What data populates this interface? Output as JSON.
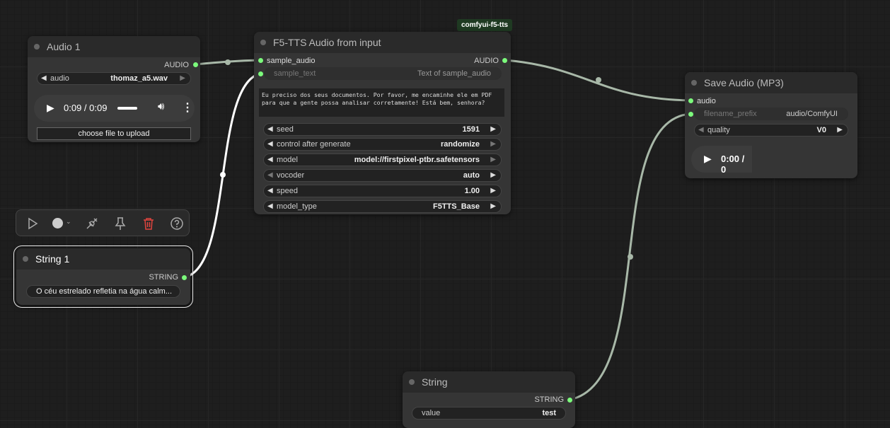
{
  "nodes": {
    "audio1": {
      "title": "Audio 1",
      "output": "AUDIO",
      "widget": {
        "label": "audio",
        "value": "thomaz_a5.wav"
      },
      "player": {
        "time": "0:09 / 0:09"
      },
      "upload_button": "choose file to upload"
    },
    "string1": {
      "title": "String 1",
      "output": "STRING",
      "value": "O céu estrelado refletia na água calm..."
    },
    "f5tts": {
      "title": "F5-TTS Audio from input",
      "badge": "comfyui-f5-tts",
      "inputs": [
        "sample_audio",
        "sample_text"
      ],
      "output": "AUDIO",
      "sample_text_hint": "Text of sample_audio",
      "text": "Eu preciso dos seus documentos. Por favor, me encaminhe ele em PDF para que a gente possa analisar corretamente! Está bem, senhora?",
      "widgets": [
        {
          "label": "seed",
          "value": "1591"
        },
        {
          "label": "control after generate",
          "value": "randomize"
        },
        {
          "label": "model",
          "value": "model://firstpixel-ptbr.safetensors"
        },
        {
          "label": "vocoder",
          "value": "auto"
        },
        {
          "label": "speed",
          "value": "1.00"
        },
        {
          "label": "model_type",
          "value": "F5TTS_Base"
        }
      ]
    },
    "save_audio": {
      "title": "Save Audio (MP3)",
      "inputs": [
        "audio",
        "filename_prefix"
      ],
      "filename_prefix_value": "audio/ComfyUI",
      "quality": {
        "label": "quality",
        "value": "V0"
      },
      "player": {
        "time": "0:00 / 0"
      }
    },
    "string": {
      "title": "String",
      "output": "STRING",
      "widget": {
        "label": "value",
        "value": "test"
      }
    }
  },
  "toolbar": {
    "icons": [
      "play-icon",
      "color-icon",
      "bypass-icon",
      "pin-icon",
      "delete-icon",
      "help-icon"
    ]
  },
  "colors": {
    "slot_pin": "#7CFB7C",
    "link": "#a8b8a8",
    "delete": "#e0443e"
  }
}
